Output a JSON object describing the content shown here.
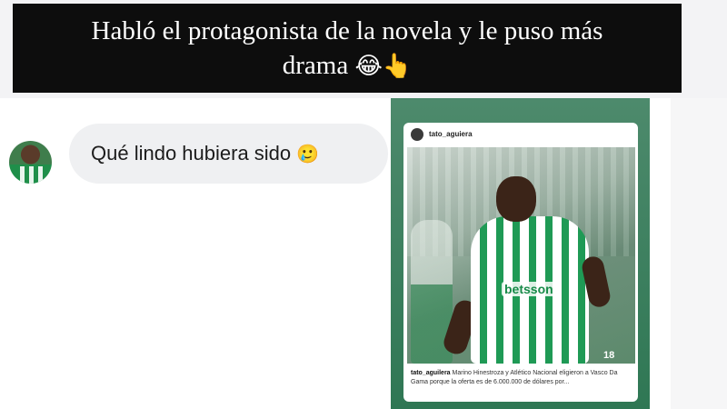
{
  "caption": {
    "line1": "Habló el protagonista de la novela y le puso más",
    "line2": "drama",
    "emojis": "😂👆"
  },
  "chat": {
    "message": {
      "text": "Qué lindo hubiera sido",
      "emoji": "🥲"
    }
  },
  "post": {
    "username": "tato_aguiera",
    "photo_text": {
      "sponsor": "betsson",
      "shirt_number": "18"
    },
    "caption_user": "tato_aguilera",
    "caption_text": "Marino Hinestroza y Atlético Nacional eligieron a Vasco Da Gama porque la oferta es de 6.000.000 de dólares por..."
  },
  "colors": {
    "caption_bg": "#0d0d0d",
    "bubble_bg": "#eff0f2",
    "story_bg": "#2f7754",
    "jersey_green": "#1f9a55"
  }
}
